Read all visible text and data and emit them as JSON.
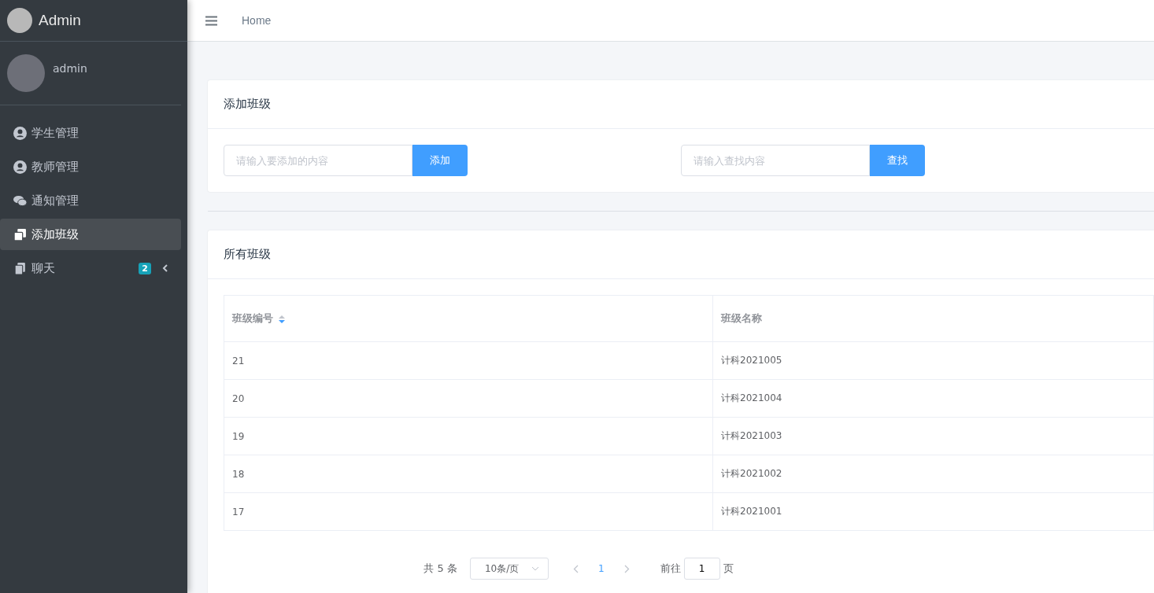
{
  "brand": {
    "title": "Admin"
  },
  "user": {
    "name": "admin"
  },
  "nav": [
    {
      "label": "学生管理",
      "selected": false
    },
    {
      "label": "教师管理",
      "selected": false
    },
    {
      "label": "通知管理",
      "selected": false
    },
    {
      "label": "添加班级",
      "selected": true
    },
    {
      "label": "聊天",
      "selected": false,
      "badge": "2"
    }
  ],
  "header": {
    "breadcrumb": "Home"
  },
  "add_card": {
    "title": "添加班级",
    "add_field": {
      "placeholder": "请输入要添加的内容"
    },
    "add_button": "添加",
    "search_field": {
      "placeholder": "请输入查找内容"
    },
    "search_button": "查找"
  },
  "list_card": {
    "title": "所有班级",
    "table": {
      "columns": [
        {
          "label": "班级编号",
          "sortable": true
        },
        {
          "label": "班级名称",
          "sortable": false
        }
      ],
      "rows": [
        [
          "21",
          "计科2021005"
        ],
        [
          "20",
          "计科2021004"
        ],
        [
          "19",
          "计科2021003"
        ],
        [
          "18",
          "计科2021002"
        ],
        [
          "17",
          "计科2021001"
        ]
      ]
    },
    "pagination": {
      "total": "共 5 条",
      "page_size": "10条/页",
      "pages": [
        {
          "label": "1",
          "selected": true
        }
      ],
      "goto_label": "前往",
      "goto_value": "1",
      "goto_suffix": "页"
    }
  }
}
